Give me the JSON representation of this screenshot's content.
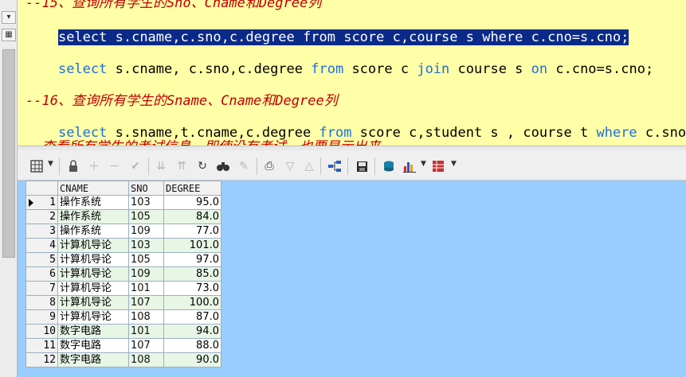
{
  "left_rail": {
    "buttons": [
      "▾",
      "▦"
    ]
  },
  "editor": {
    "lines": [
      {
        "type": "comment",
        "text": "--15、查询所有学生的Sno、Cname和Degree列"
      },
      {
        "type": "selected",
        "parts": [
          {
            "k": false,
            "t": "select "
          },
          {
            "k": false,
            "t": "s.cname,c.sno,c.degree "
          },
          {
            "k": true,
            "t": "from"
          },
          {
            "k": false,
            "t": " score c,course s "
          },
          {
            "k": true,
            "t": "where"
          },
          {
            "k": false,
            "t": " c.cno=s.cno;"
          }
        ]
      },
      {
        "type": "code",
        "parts": [
          {
            "k": true,
            "t": "select"
          },
          {
            "k": false,
            "t": " s.cname, c.sno,c.degree "
          },
          {
            "k": true,
            "t": "from"
          },
          {
            "k": false,
            "t": " score c "
          },
          {
            "k": true,
            "t": "join"
          },
          {
            "k": false,
            "t": " course s "
          },
          {
            "k": true,
            "t": "on"
          },
          {
            "k": false,
            "t": " c.cno=s.cno;"
          }
        ]
      },
      {
        "type": "comment",
        "text": "--16、查询所有学生的Sname、Cname和Degree列"
      },
      {
        "type": "code",
        "parts": [
          {
            "k": true,
            "t": "select"
          },
          {
            "k": false,
            "t": " s.sname,t.cname,c.degree "
          },
          {
            "k": true,
            "t": "from"
          },
          {
            "k": false,
            "t": " score c,student s , course t "
          },
          {
            "k": true,
            "t": "where"
          },
          {
            "k": false,
            "t": " c.sno="
          }
        ]
      },
      {
        "type": "comment",
        "text": "--查看所有学生的考试信息，即使没有考试，也要显示出来"
      }
    ]
  },
  "toolbar": {
    "icons": [
      "grid-view-icon",
      "lock-icon",
      "add-record-icon",
      "delete-record-icon",
      "post-edit-icon",
      "filter-down-icon",
      "filter-up-icon",
      "refresh-icon",
      "find-icon",
      "clear-icon",
      "print-icon",
      "move-down-icon",
      "move-up-icon",
      "query-plan-icon",
      "save-icon",
      "export-icon",
      "chart-icon",
      "table-options-icon"
    ]
  },
  "grid": {
    "columns": [
      "CNAME",
      "SNO",
      "DEGREE"
    ],
    "rows": [
      {
        "n": "1",
        "cname": "操作系统",
        "sno": "103",
        "degree": "95.0"
      },
      {
        "n": "2",
        "cname": "操作系统",
        "sno": "105",
        "degree": "84.0"
      },
      {
        "n": "3",
        "cname": "操作系统",
        "sno": "109",
        "degree": "77.0"
      },
      {
        "n": "4",
        "cname": "计算机导论",
        "sno": "103",
        "degree": "101.0"
      },
      {
        "n": "5",
        "cname": "计算机导论",
        "sno": "105",
        "degree": "97.0"
      },
      {
        "n": "6",
        "cname": "计算机导论",
        "sno": "109",
        "degree": "85.0"
      },
      {
        "n": "7",
        "cname": "计算机导论",
        "sno": "101",
        "degree": "73.0"
      },
      {
        "n": "8",
        "cname": "计算机导论",
        "sno": "107",
        "degree": "100.0"
      },
      {
        "n": "9",
        "cname": "计算机导论",
        "sno": "108",
        "degree": "87.0"
      },
      {
        "n": "10",
        "cname": "数字电路",
        "sno": "101",
        "degree": "94.0"
      },
      {
        "n": "11",
        "cname": "数字电路",
        "sno": "107",
        "degree": "88.0"
      },
      {
        "n": "12",
        "cname": "数字电路",
        "sno": "108",
        "degree": "90.0"
      }
    ]
  }
}
